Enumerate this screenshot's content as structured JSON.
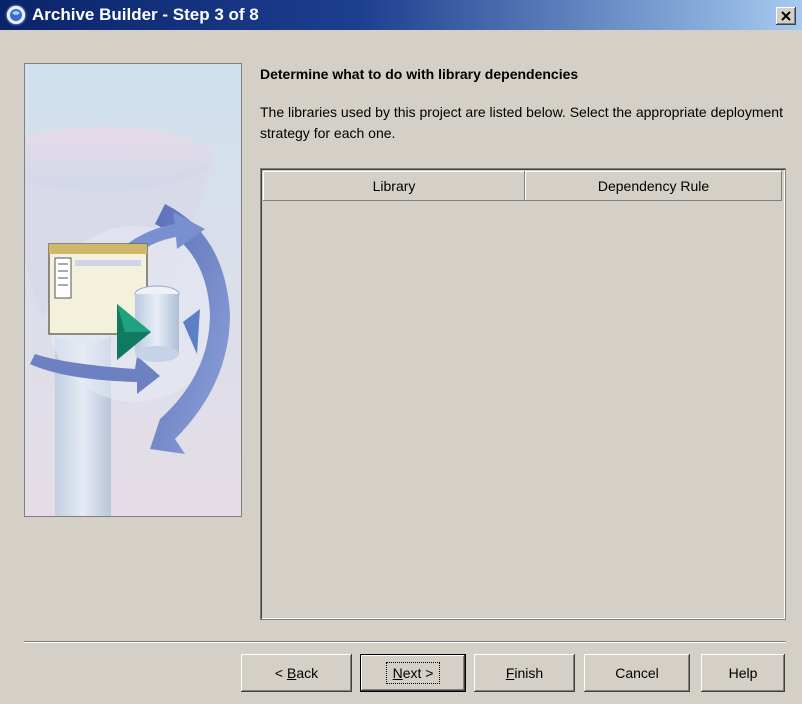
{
  "window": {
    "title": "Archive Builder - Step 3 of 8"
  },
  "page": {
    "heading": "Determine what to do with library dependencies",
    "description": "The libraries used by this project are listed below. Select the appropriate deployment strategy for each one."
  },
  "table": {
    "columns": [
      "Library",
      "Dependency Rule"
    ],
    "rows": []
  },
  "buttons": {
    "back": {
      "prefix": "< ",
      "mnemonic": "B",
      "rest": "ack"
    },
    "next": {
      "mnemonic": "N",
      "rest": "ext >"
    },
    "finish": {
      "mnemonic": "F",
      "rest": "inish"
    },
    "cancel": "Cancel",
    "help": "Help"
  },
  "icons": {
    "title": "app-globe-icon",
    "close": "close-icon",
    "art": "deployment-wizard-illustration"
  }
}
